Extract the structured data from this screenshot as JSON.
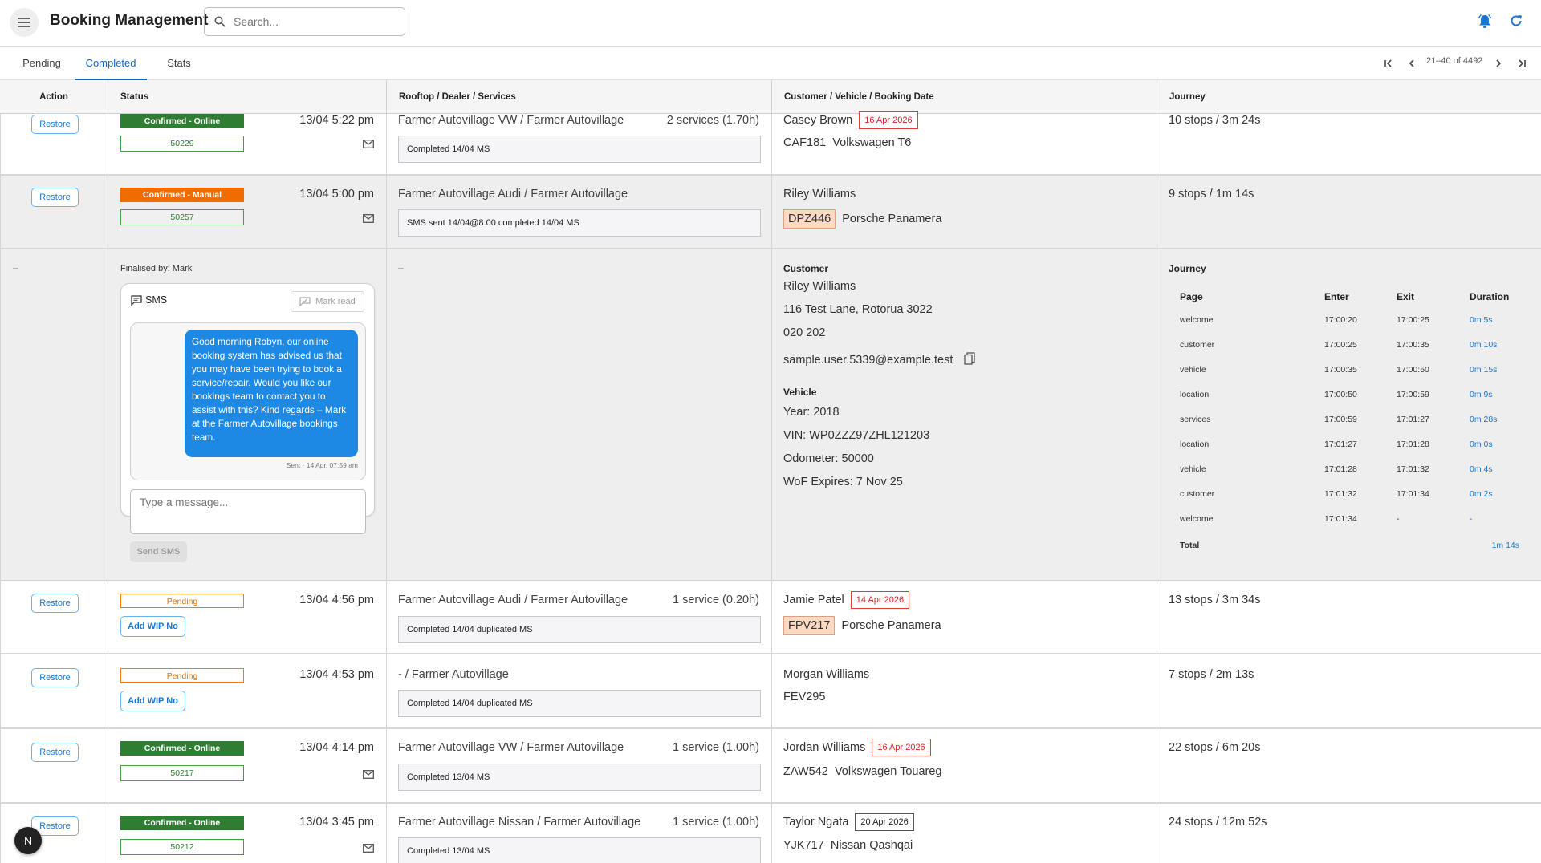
{
  "header": {
    "title": "Booking Management",
    "search_placeholder": "Search..."
  },
  "tabs": [
    "Pending",
    "Completed",
    "Stats"
  ],
  "active_tab": "Completed",
  "pager": {
    "range": "21–40 of 4492"
  },
  "columns": [
    "Action",
    "Status",
    "Rooftop / Dealer / Services",
    "Customer / Vehicle / Booking Date",
    "Journey"
  ],
  "rows": [
    {
      "action": "Restore",
      "status": "Confirmed - Online",
      "wip": "50229",
      "datetime": "13/04 5:22 pm",
      "dealer": "Farmer Autovillage VW / Farmer Autovillage",
      "services": "2 services (1.70h)",
      "note": "Completed 14/04 MS",
      "customer": "Casey Brown",
      "booking_date": "16 Apr 2026",
      "rego": "CAF181",
      "vehicle": "Volkswagen T6",
      "journey": "10 stops / 3m 24s"
    },
    {
      "action": "Restore",
      "status": "Confirmed - Manual",
      "wip": "50257",
      "datetime": "13/04 5:00 pm",
      "dealer": "Farmer Autovillage Audi / Farmer Autovillage",
      "services": "",
      "note": "SMS sent 14/04@8.00 completed 14/04 MS",
      "customer": "Riley Williams",
      "booking_date": "",
      "rego": "DPZ446",
      "vehicle": "Porsche Panamera",
      "journey": "9 stops / 1m 14s"
    },
    {
      "action": "Restore",
      "status": "Pending",
      "wip_button": "Add WIP No",
      "datetime": "13/04 4:56 pm",
      "dealer": "Farmer Autovillage Audi / Farmer Autovillage",
      "services": "1 service (0.20h)",
      "note": "Completed 14/04 duplicated MS",
      "customer": "Jamie Patel",
      "booking_date": "14 Apr 2026",
      "rego": "FPV217",
      "vehicle": "Porsche Panamera",
      "journey": "13 stops / 3m 34s"
    },
    {
      "action": "Restore",
      "status": "Pending",
      "wip_button": "Add WIP No",
      "datetime": "13/04 4:53 pm",
      "dealer": "- / Farmer Autovillage",
      "services": "",
      "note": "Completed 14/04 duplicated MS",
      "customer": "Morgan Williams",
      "booking_date": "",
      "rego": "FEV295",
      "vehicle": "",
      "journey": "7 stops / 2m 13s"
    },
    {
      "action": "Restore",
      "status": "Confirmed - Online",
      "wip": "50217",
      "datetime": "13/04 4:14 pm",
      "dealer": "Farmer Autovillage VW / Farmer Autovillage",
      "services": "1 service (1.00h)",
      "note": "Completed 13/04 MS",
      "customer": "Jordan Williams",
      "booking_date": "16 Apr 2026",
      "rego": "ZAW542",
      "vehicle": "Volkswagen Touareg",
      "journey": "22 stops / 6m 20s"
    },
    {
      "action": "Restore",
      "status": "Confirmed - Online",
      "wip": "50212",
      "datetime": "13/04 3:45 pm",
      "dealer": "Farmer Autovillage Nissan / Farmer Autovillage",
      "services": "1 service (1.00h)",
      "note": "Completed 13/04 MS",
      "customer": "Taylor Ngata",
      "booking_date": "20 Apr 2026",
      "rego": "YJK717",
      "vehicle": "Nissan Qashqai",
      "journey": "24 stops / 12m 52s"
    }
  ],
  "expanded": {
    "action_dash": "–",
    "dealer_dash": "–",
    "finalised": "Finalised by: Mark",
    "sms": {
      "title": "SMS",
      "mark_read": "Mark read",
      "message": "Good morning Robyn, our online booking system has advised us that you may have been trying to book a service/repair. Would you like our bookings team to contact you to assist with this? Kind regards – Mark at the Farmer Autovillage bookings team.",
      "sent_meta": "Sent · 14 Apr, 07:59 am",
      "input_placeholder": "Type a message...",
      "send_label": "Send SMS"
    },
    "customer": {
      "heading": "Customer",
      "name": "Riley Williams",
      "address": "116 Test Lane, Rotorua 3022",
      "phone": "020 202",
      "email": "sample.user.5339@example.test"
    },
    "vehicle": {
      "heading": "Vehicle",
      "year": "Year: 2018",
      "vin": "VIN: WP0ZZZ97ZHL121203",
      "odometer": "Odometer: 50000",
      "wof": "WoF Expires: 7 Nov 25"
    },
    "journey": {
      "heading": "Journey",
      "columns": [
        "Page",
        "Enter",
        "Exit",
        "Duration"
      ],
      "rows": [
        [
          "welcome",
          "17:00:20",
          "17:00:25",
          "0m 5s"
        ],
        [
          "customer",
          "17:00:25",
          "17:00:35",
          "0m 10s"
        ],
        [
          "vehicle",
          "17:00:35",
          "17:00:50",
          "0m 15s"
        ],
        [
          "location",
          "17:00:50",
          "17:00:59",
          "0m 9s"
        ],
        [
          "services",
          "17:00:59",
          "17:01:27",
          "0m 28s"
        ],
        [
          "location",
          "17:01:27",
          "17:01:28",
          "0m 0s"
        ],
        [
          "vehicle",
          "17:01:28",
          "17:01:32",
          "0m 4s"
        ],
        [
          "customer",
          "17:01:32",
          "17:01:34",
          "0m 2s"
        ],
        [
          "welcome",
          "17:01:34",
          "-",
          "-"
        ]
      ],
      "total_label": "Total",
      "total_value": "1m 14s"
    }
  },
  "fab_label": "N",
  "icons": {
    "menu": "menu-icon",
    "search": "search-icon",
    "bell": "bell-icon",
    "refresh": "refresh-icon",
    "mail": "mail-icon",
    "copy": "copy-icon",
    "sms": "chat-icon"
  },
  "colors": {
    "accent": "#1565c0",
    "online": "#2e7d32",
    "manual": "#ef6c00",
    "bell": "#1976d2"
  }
}
